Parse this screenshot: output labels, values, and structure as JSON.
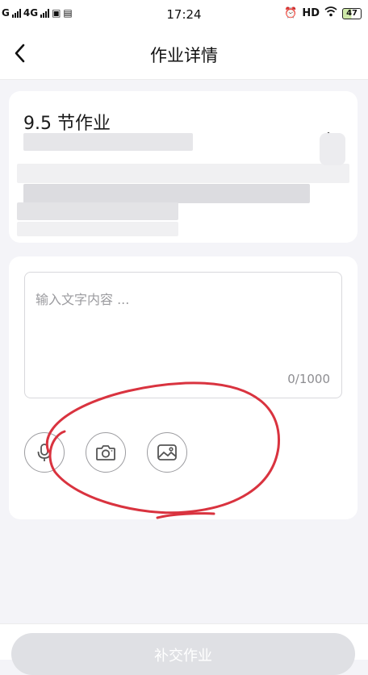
{
  "status_bar": {
    "left": "G",
    "network": "4G",
    "time": "17:24",
    "hd": "HD",
    "battery": "47"
  },
  "header": {
    "title": "作业详情"
  },
  "homework": {
    "title": "9.5 节作业"
  },
  "editor": {
    "placeholder": "输入文字内容 ...",
    "counter": "0/1000"
  },
  "tools": [
    "microphone-icon",
    "camera-icon",
    "image-icon"
  ],
  "footer": {
    "submit_label": "补交作业"
  },
  "colors": {
    "annotation": "#d9333f",
    "background": "#f4f4f8",
    "submit_disabled": "#dfe0e4"
  }
}
